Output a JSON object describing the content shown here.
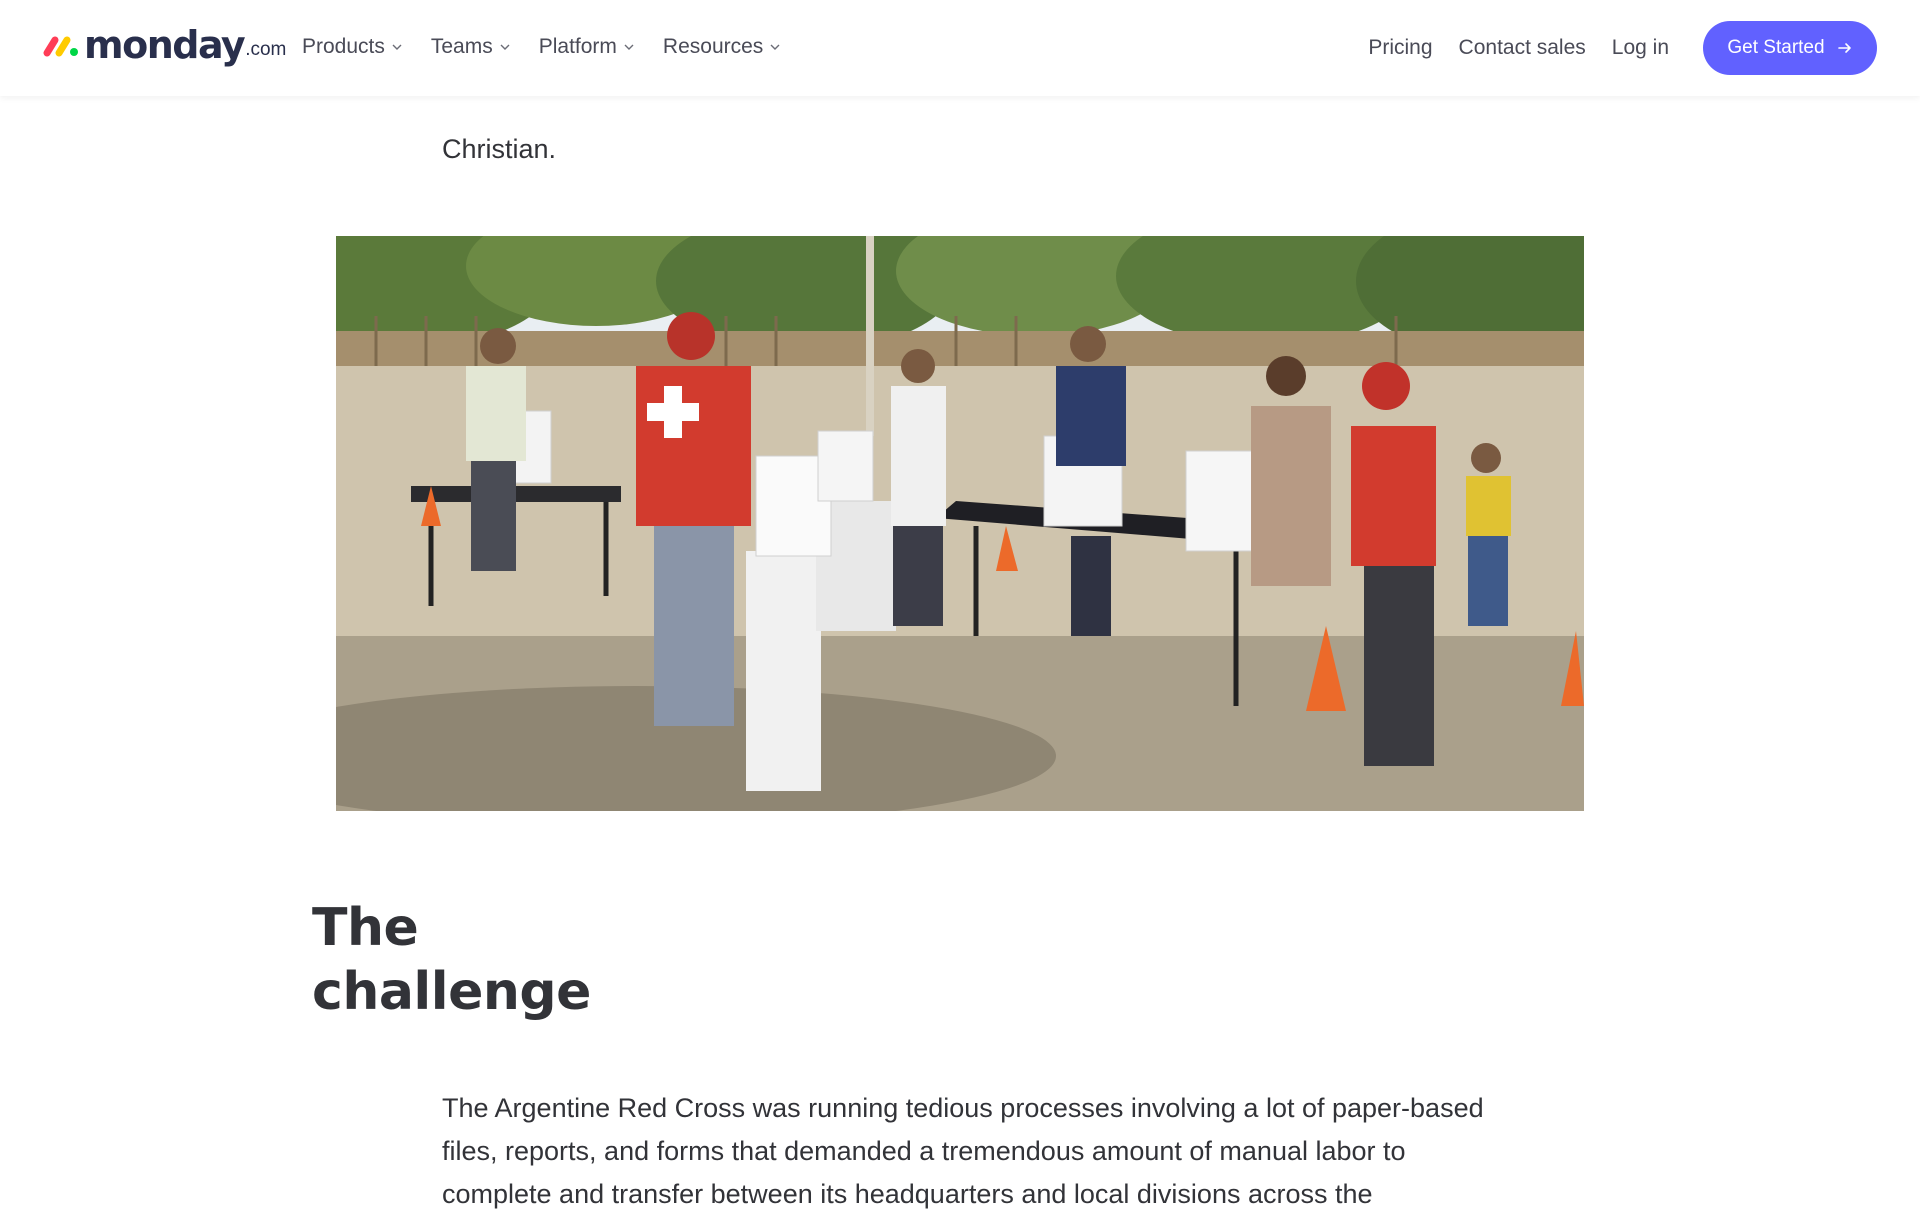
{
  "header": {
    "logo": {
      "brand": "monday",
      "suffix": ".com",
      "mark_colors": [
        "#ff3d57",
        "#ffcb00",
        "#00d647"
      ]
    },
    "nav_left": [
      {
        "label": "Products",
        "icon": "chevron-down-icon"
      },
      {
        "label": "Teams",
        "icon": "chevron-down-icon"
      },
      {
        "label": "Platform",
        "icon": "chevron-down-icon"
      },
      {
        "label": "Resources",
        "icon": "chevron-down-icon"
      }
    ],
    "nav_right": {
      "pricing": "Pricing",
      "contact": "Contact sales",
      "login": "Log in"
    },
    "cta": {
      "label": "Get Started",
      "icon": "arrow-right-icon",
      "color": "#6161ff"
    }
  },
  "content": {
    "intro_tail": "Christian.",
    "photo": {
      "subject": "Red Cross volunteers at tables with supply boxes outdoors"
    },
    "heading": {
      "line1": "The",
      "line2": "challenge"
    },
    "body_lines": [
      "The Argentine Red Cross was running tedious processes involving a lot of paper-based",
      "files, reports, and forms that demanded a tremendous amount of manual labor to",
      "complete and transfer between its headquarters and local divisions across the"
    ]
  }
}
